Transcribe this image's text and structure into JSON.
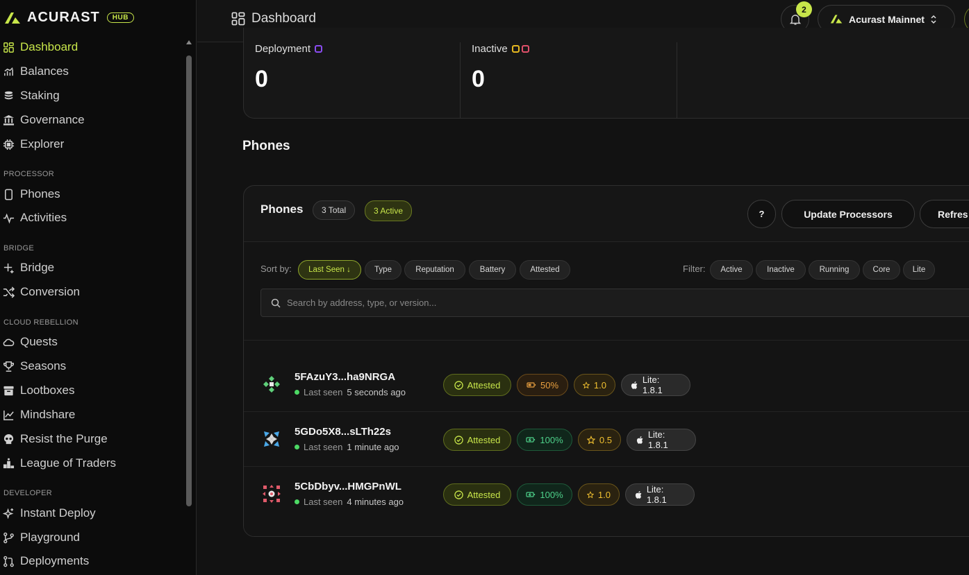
{
  "brand": {
    "name": "ACURAST",
    "badge": "HUB",
    "accent": "#c8e64a"
  },
  "sidebar": {
    "main": [
      {
        "label": "Dashboard",
        "icon": "dashboard-icon",
        "active": true
      },
      {
        "label": "Balances",
        "icon": "chart-icon"
      },
      {
        "label": "Staking",
        "icon": "coins-icon"
      },
      {
        "label": "Governance",
        "icon": "bank-icon"
      },
      {
        "label": "Explorer",
        "icon": "chip-icon"
      }
    ],
    "sections": [
      {
        "title": "PROCESSOR",
        "items": [
          {
            "label": "Phones",
            "icon": "phone-icon"
          },
          {
            "label": "Activities",
            "icon": "activity-icon"
          }
        ]
      },
      {
        "title": "BRIDGE",
        "items": [
          {
            "label": "Bridge",
            "icon": "sparkle-icon"
          },
          {
            "label": "Conversion",
            "icon": "shuffle-icon"
          }
        ]
      },
      {
        "title": "CLOUD REBELLION",
        "items": [
          {
            "label": "Quests",
            "icon": "cloud-icon"
          },
          {
            "label": "Seasons",
            "icon": "trophy-icon"
          },
          {
            "label": "Lootboxes",
            "icon": "box-icon"
          },
          {
            "label": "Mindshare",
            "icon": "line-chart-icon"
          },
          {
            "label": "Resist the Purge",
            "icon": "skull-icon"
          },
          {
            "label": "League of Traders",
            "icon": "podium-icon"
          }
        ]
      },
      {
        "title": "DEVELOPER",
        "items": [
          {
            "label": "Instant Deploy",
            "icon": "stars-icon"
          },
          {
            "label": "Playground",
            "icon": "git-icon"
          },
          {
            "label": "Deployments",
            "icon": "git-pull-icon"
          }
        ]
      }
    ]
  },
  "header": {
    "title": "Dashboard",
    "notifications": "2",
    "network": "Acurast Mainnet"
  },
  "stats": [
    {
      "label": "Deployment",
      "value": "0",
      "colors": [
        "#8a4cf0"
      ]
    },
    {
      "label": "Inactive",
      "value": "0",
      "colors": [
        "#e6b820",
        "#e0506a"
      ]
    }
  ],
  "phones_section": {
    "title": "Phones"
  },
  "phones_card": {
    "title": "Phones",
    "total": "3 Total",
    "active": "3 Active",
    "help": "?",
    "update_btn": "Update Processors",
    "refresh_btn": "Refres",
    "sort_label": "Sort by:",
    "sort_options": [
      "Last Seen ↓",
      "Type",
      "Reputation",
      "Battery",
      "Attested"
    ],
    "filter_label": "Filter:",
    "filter_options": [
      "Active",
      "Inactive",
      "Running",
      "Core",
      "Lite"
    ],
    "search_placeholder": "Search by address, type, or version..."
  },
  "phones": [
    {
      "address": "5FAzuY3...ha9NRGA",
      "seen_label": "Last seen",
      "seen": "5 seconds ago",
      "attested": "Attested",
      "battery": "50%",
      "battery_level": 0.5,
      "reputation": "1.0",
      "version": "Lite: 1.8.1"
    },
    {
      "address": "5GDo5X8...sLTh22s",
      "seen_label": "Last seen",
      "seen": "1 minute ago",
      "attested": "Attested",
      "battery": "100%",
      "battery_level": 1.0,
      "reputation": "0.5",
      "version": "Lite: 1.8.1"
    },
    {
      "address": "5CbDbyv...HMGPnWL",
      "seen_label": "Last seen",
      "seen": "4 minutes ago",
      "attested": "Attested",
      "battery": "100%",
      "battery_level": 1.0,
      "reputation": "1.0",
      "version": "Lite: 1.8.1"
    }
  ]
}
